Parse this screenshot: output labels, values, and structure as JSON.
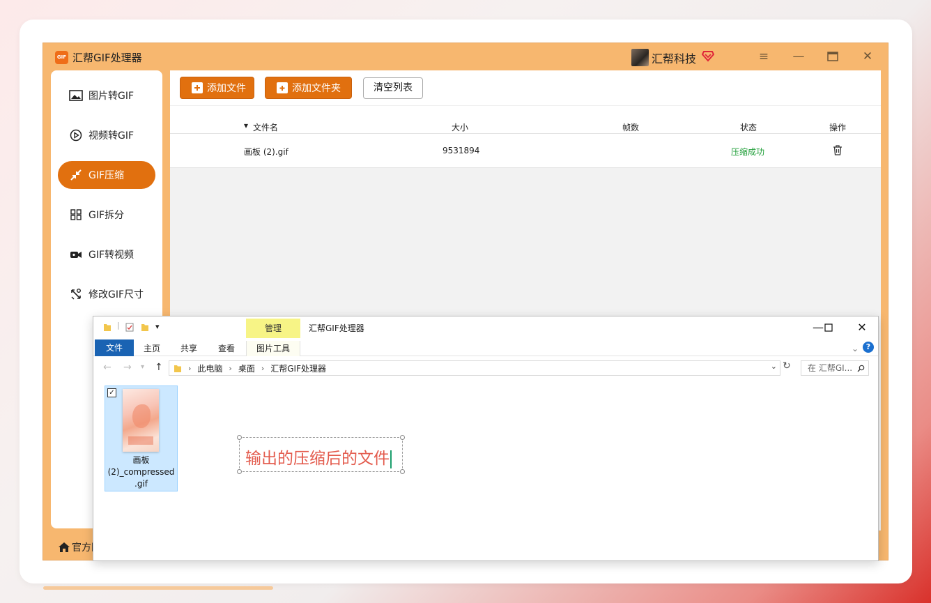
{
  "app": {
    "logo_text": "GIF",
    "title": "汇帮GIF处理器",
    "user_name": "汇帮科技",
    "window_controls": [
      "menu-icon",
      "minimize-icon",
      "maximize-icon",
      "close-icon"
    ]
  },
  "sidebar": {
    "items": [
      {
        "label": "图片转GIF",
        "icon": "image-icon"
      },
      {
        "label": "视频转GIF",
        "icon": "play-icon"
      },
      {
        "label": "GIF压缩",
        "icon": "compress-icon",
        "active": true
      },
      {
        "label": "GIF拆分",
        "icon": "split-icon"
      },
      {
        "label": "GIF转视频",
        "icon": "camera-icon"
      },
      {
        "label": "修改GIF尺寸",
        "icon": "resize-icon"
      }
    ],
    "footer_label": "官方网"
  },
  "toolbar": {
    "add_file": "添加文件",
    "add_folder": "添加文件夹",
    "clear_list": "清空列表"
  },
  "table": {
    "columns": [
      "文件名",
      "大小",
      "帧数",
      "状态",
      "操作"
    ],
    "rows": [
      {
        "name": "画板 (2).gif",
        "size": "9531894",
        "frames": "",
        "status": "压缩成功"
      }
    ]
  },
  "explorer": {
    "window_title": "汇帮GIF处理器",
    "context_tab": "管理",
    "ribbon_tabs": [
      "文件",
      "主页",
      "共享",
      "查看",
      "图片工具"
    ],
    "breadcrumb": [
      "此电脑",
      "桌面",
      "汇帮GIF处理器"
    ],
    "search_placeholder": "在 汇帮GI...",
    "file": {
      "name_line1": "画板",
      "name_line2": "(2)_compressed",
      "name_line3": ".gif"
    },
    "annotation": "输出的压缩后的文件"
  },
  "colors": {
    "accent": "#e1700f",
    "frame": "#f7b76f",
    "success": "#1e9e37",
    "annotation": "#e35b4d"
  }
}
